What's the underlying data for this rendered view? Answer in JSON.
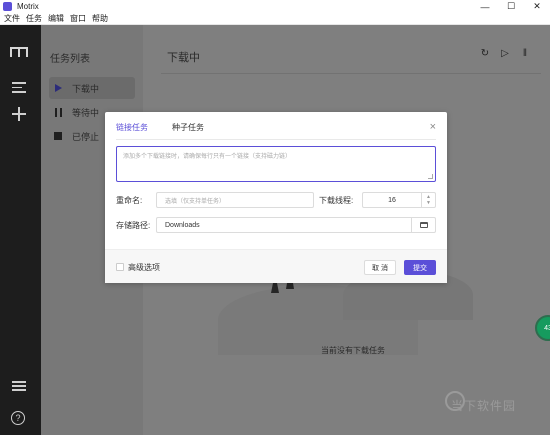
{
  "window": {
    "title": "Motrix",
    "controls": [
      "—",
      "☐",
      "✕"
    ]
  },
  "menu": [
    "文件",
    "任务",
    "编辑",
    "窗口",
    "帮助"
  ],
  "sidebar": {
    "title": "任务列表",
    "items": [
      {
        "label": "下载中",
        "icon": "play-icon",
        "active": true
      },
      {
        "label": "等待中",
        "icon": "pause-icon",
        "active": false
      },
      {
        "label": "已停止",
        "icon": "stop-icon",
        "active": false
      }
    ]
  },
  "main": {
    "title": "下载中",
    "tools": [
      "↻",
      "▷",
      "‖"
    ],
    "empty_text": "当前没有下载任务",
    "badge": "43",
    "watermark": "当下软件园"
  },
  "dialog": {
    "tabs": [
      "链接任务",
      "种子任务"
    ],
    "active_tab": 0,
    "close": "×",
    "uri_placeholder": "添加多个下载链接时，请确保每行只有一个链接（支持磁力链）",
    "rename_label": "重命名:",
    "rename_placeholder": "选填（仅支持单任务）",
    "split_label": "下载线程:",
    "split_value": "16",
    "path_label": "存储路径:",
    "path_value": "Downloads",
    "advanced_label": "高级选项",
    "cancel_label": "取 消",
    "submit_label": "提交"
  },
  "colors": {
    "accent": "#5b4fd8",
    "rail": "#1d1d1d",
    "badge": "#169b5e"
  }
}
